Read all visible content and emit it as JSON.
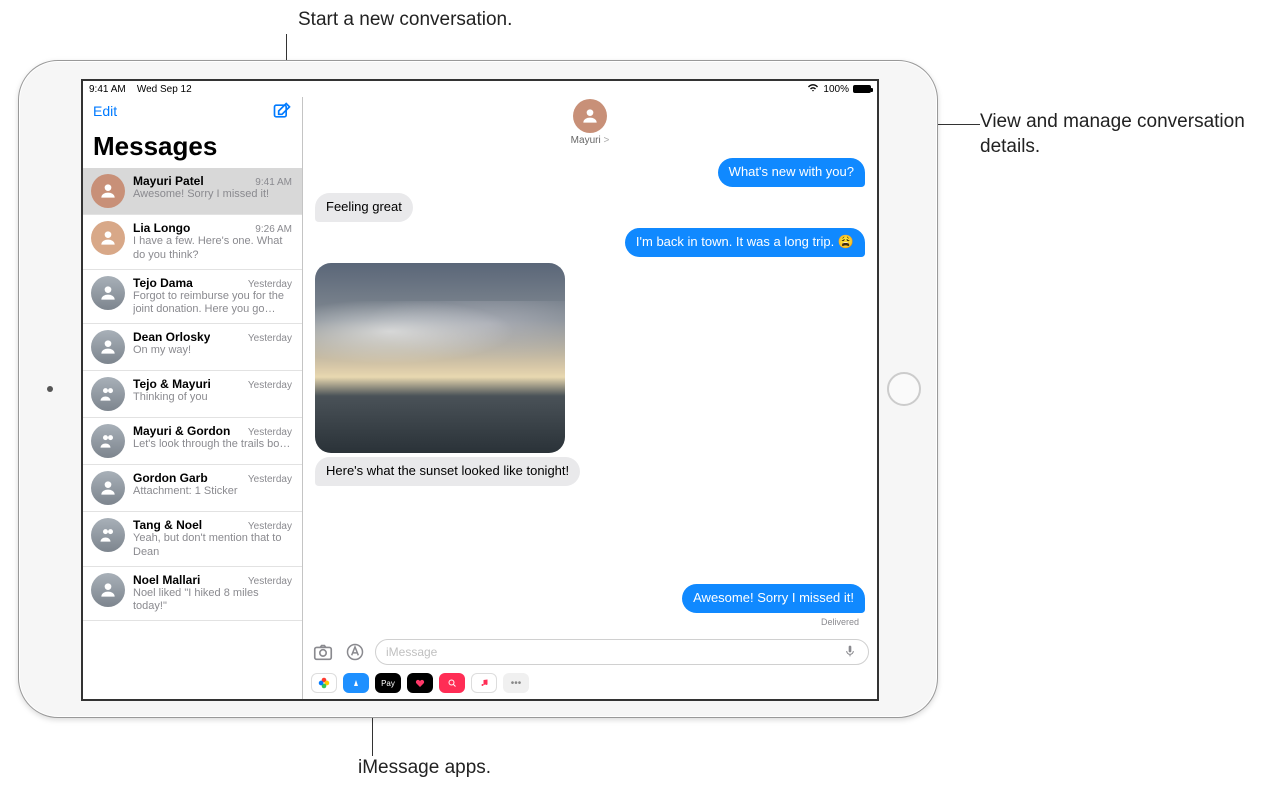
{
  "callouts": {
    "compose": "Start a new conversation.",
    "details": "View and manage conversation details.",
    "appdrawer": "iMessage apps."
  },
  "status": {
    "time": "9:41 AM",
    "date": "Wed Sep 12",
    "battery": "100%"
  },
  "sidebar": {
    "edit": "Edit",
    "title": "Messages",
    "items": [
      {
        "name": "Mayuri Patel",
        "time": "9:41 AM",
        "preview": "Awesome! Sorry I missed it!"
      },
      {
        "name": "Lia Longo",
        "time": "9:26 AM",
        "preview": "I have a few. Here's one. What do you think?"
      },
      {
        "name": "Tejo Dama",
        "time": "Yesterday",
        "preview": "Forgot to reimburse you for the joint donation. Here you go…"
      },
      {
        "name": "Dean Orlosky",
        "time": "Yesterday",
        "preview": "On my way!"
      },
      {
        "name": "Tejo & Mayuri",
        "time": "Yesterday",
        "preview": "Thinking of you"
      },
      {
        "name": "Mayuri & Gordon",
        "time": "Yesterday",
        "preview": "Let's look through the trails bo…"
      },
      {
        "name": "Gordon Garb",
        "time": "Yesterday",
        "preview": "Attachment: 1 Sticker"
      },
      {
        "name": "Tang & Noel",
        "time": "Yesterday",
        "preview": "Yeah, but don't mention that to Dean"
      },
      {
        "name": "Noel Mallari",
        "time": "Yesterday",
        "preview": "Noel liked \"I hiked 8 miles today!\""
      }
    ]
  },
  "chat": {
    "contact": "Mayuri",
    "contact_chevron": ">",
    "messages": [
      {
        "type": "sent",
        "text": "What's new with you?"
      },
      {
        "type": "recv",
        "text": "Feeling great"
      },
      {
        "type": "sent",
        "text": "I'm back in town. It was a long trip. 😩"
      },
      {
        "type": "recv_image",
        "text": ""
      },
      {
        "type": "recv",
        "text": "Here's what the sunset looked like tonight!"
      },
      {
        "type": "sent",
        "text": "Awesome! Sorry I missed it!"
      }
    ],
    "delivered": "Delivered",
    "input_placeholder": "iMessage"
  },
  "apps": {
    "photos": "Photos",
    "appstore": "App Store",
    "applepay": "Pay",
    "music": "Music",
    "more": "•••"
  }
}
